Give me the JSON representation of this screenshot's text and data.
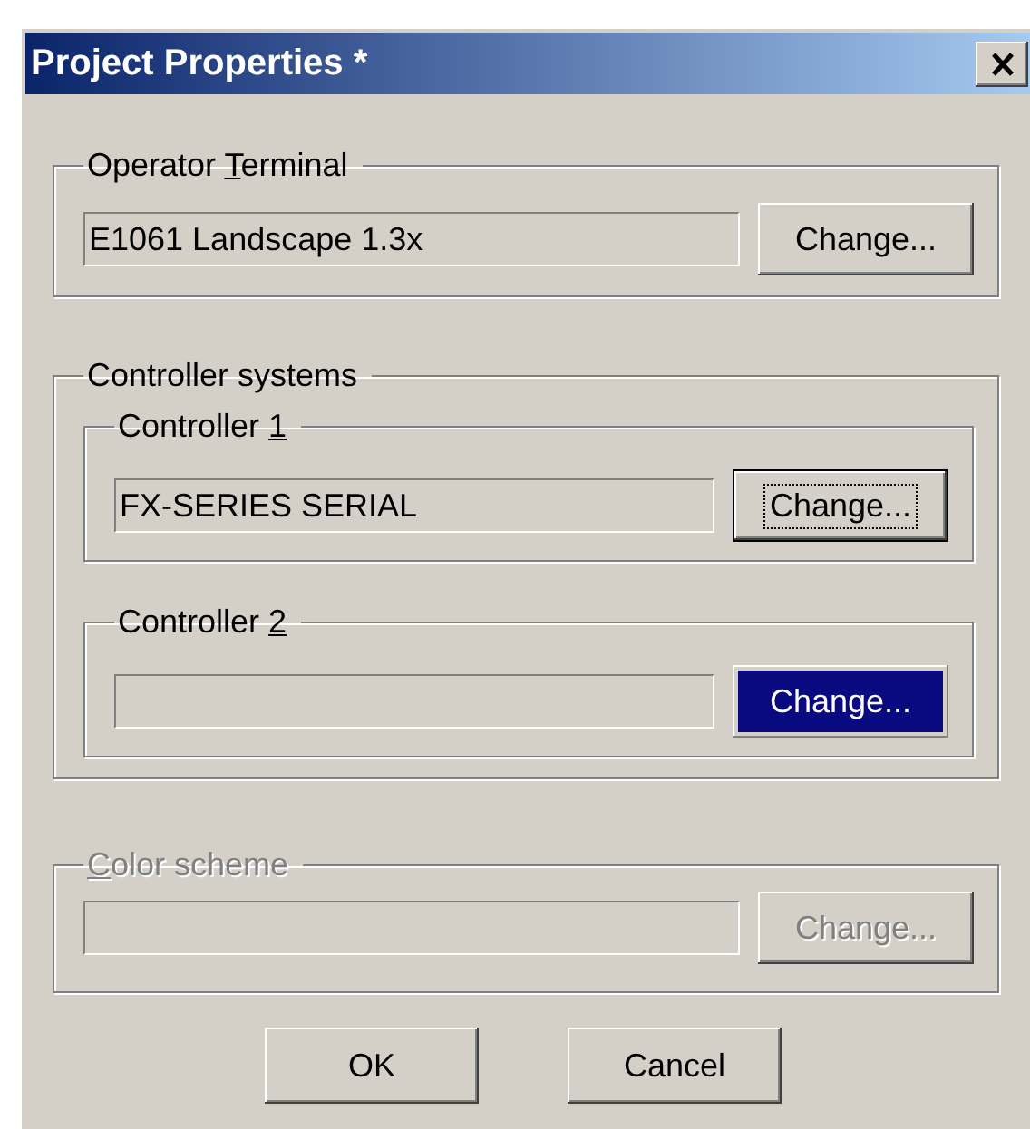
{
  "window": {
    "title": "Project Properties *"
  },
  "operator_terminal": {
    "title": {
      "before": "Operator ",
      "key": "T",
      "after": "erminal"
    },
    "disabled": false,
    "field": {
      "value": "E1061 Landscape 1.3x"
    },
    "button": {
      "label": "Change...",
      "focused": false,
      "highlighted": false
    }
  },
  "controller_systems": {
    "title": {
      "before": "Controller systems"
    },
    "controllers": [
      {
        "title": {
          "before": "Controller ",
          "key": "1"
        },
        "disabled": false,
        "field": {
          "value": "FX-SERIES SERIAL"
        },
        "button": {
          "label": "Change...",
          "focused": true,
          "highlighted": false
        }
      },
      {
        "title": {
          "before": "Controller ",
          "key": "2"
        },
        "disabled": false,
        "button": {
          "label": "Change...",
          "focused": false,
          "highlighted": true
        }
      }
    ]
  },
  "color_scheme": {
    "title": {
      "key": "C",
      "after": "olor scheme"
    },
    "disabled": true,
    "button": {
      "label": "Change...",
      "focused": false,
      "highlighted": false
    }
  },
  "buttons": [
    {
      "label": "OK"
    },
    {
      "label": "Cancel"
    }
  ]
}
